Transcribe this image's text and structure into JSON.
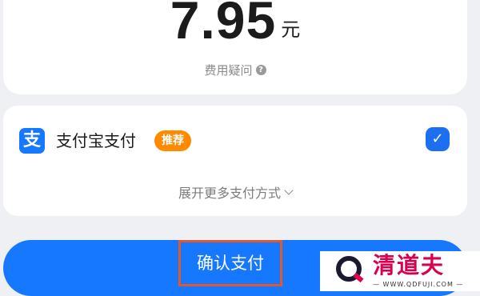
{
  "summary": {
    "amount": "7.95",
    "unit": "元",
    "fee_question": "费用疑问"
  },
  "payment": {
    "logo_glyph": "支",
    "method_label": "支付宝支付",
    "badge": "推荐",
    "check_glyph": "✓",
    "expand_label": "展开更多支付方式"
  },
  "confirm": {
    "label": "确认支付"
  },
  "watermark": {
    "title": "清道夫",
    "url": "— WWW.QDFUJI.COM —"
  },
  "colors": {
    "primary": "#1677ff",
    "badge": "#ff8a00",
    "highlight_border": "#e1582e"
  },
  "icons": {
    "help": "question-circle-icon",
    "alipay": "alipay-logo-icon",
    "check": "checkbox-checked-icon",
    "expand": "chevron-down-icon"
  }
}
